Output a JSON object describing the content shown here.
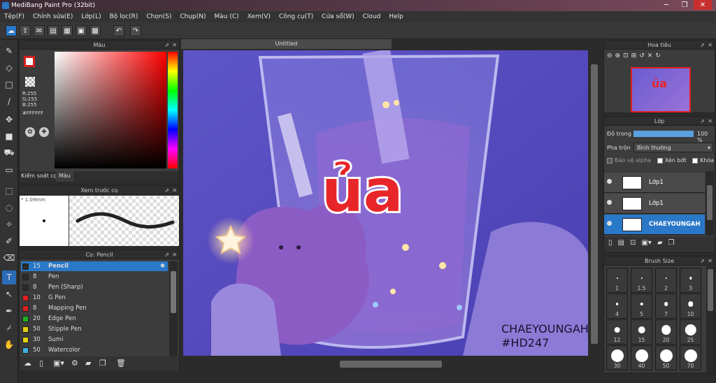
{
  "window": {
    "title": "MediBang Paint Pro (32bit)"
  },
  "menu": [
    "Tệp(F)",
    "Chỉnh sửa(E)",
    "Lớp(L)",
    "Bộ lọc(R)",
    "Chọn(S)",
    "Chụp(N)",
    "Màu (C)",
    "Xem(V)",
    "Công cụ(T)",
    "Cửa sổ(W)",
    "Cloud",
    "Help"
  ],
  "color_panel": {
    "title": "Màu",
    "r": "R:255",
    "g": "G:255",
    "b": "B:255",
    "hex": "#FFFFFF",
    "tab_control": "Kiểm soát cọ",
    "tab_color": "Màu",
    "primary": "#d42020",
    "secondary": "#ffffff"
  },
  "brush_preview": {
    "title": "Xem trước cọ",
    "size": "* 1.09mm"
  },
  "brush_panel": {
    "title": "Cọ: Pencil",
    "brushes": [
      {
        "size": "15",
        "name": "Pencil",
        "color": "#2a2a2a",
        "selected": true
      },
      {
        "size": "8",
        "name": "Pen",
        "color": "#2a2a2a"
      },
      {
        "size": "8",
        "name": "Pen (Sharp)",
        "color": "#2a2a2a"
      },
      {
        "size": "10",
        "name": "G Pen",
        "color": "#e02020"
      },
      {
        "size": "8",
        "name": "Mapping Pen",
        "color": "#e02020"
      },
      {
        "size": "20",
        "name": "Edge Pen",
        "color": "#20b020"
      },
      {
        "size": "50",
        "name": "Stipple Pen",
        "color": "#e0d010"
      },
      {
        "size": "30",
        "name": "Sumi",
        "color": "#e0d010"
      },
      {
        "size": "50",
        "name": "Watercolor",
        "color": "#40b0e0"
      }
    ]
  },
  "canvas": {
    "tab": "Untitled",
    "sticker_text": "ủa",
    "credit1": "CHAEYOUNGAH",
    "credit2": "#HD247"
  },
  "navigator": {
    "title": "Hoa tiêu"
  },
  "layers": {
    "title": "Lớp",
    "opacity_label": "Độ trong",
    "opacity_value": "100 %",
    "opacity_fraction": 1.0,
    "blend_label": "Pha trộn",
    "blend_value": "Bình thường",
    "protect_alpha": "Bảo vệ alpha",
    "clip": "Xén bớt",
    "lock": "Khóa",
    "items": [
      {
        "name": "Lớp1",
        "selected": false
      },
      {
        "name": "Lớp1",
        "selected": false
      },
      {
        "name": "CHAEYOUNGAH",
        "selected": true
      }
    ]
  },
  "brush_size": {
    "title": "Brush Size",
    "sizes": [
      "1",
      "1.5",
      "2",
      "3",
      "4",
      "5",
      "7",
      "10",
      "12",
      "15",
      "20",
      "25",
      "30",
      "40",
      "50",
      "70"
    ]
  }
}
